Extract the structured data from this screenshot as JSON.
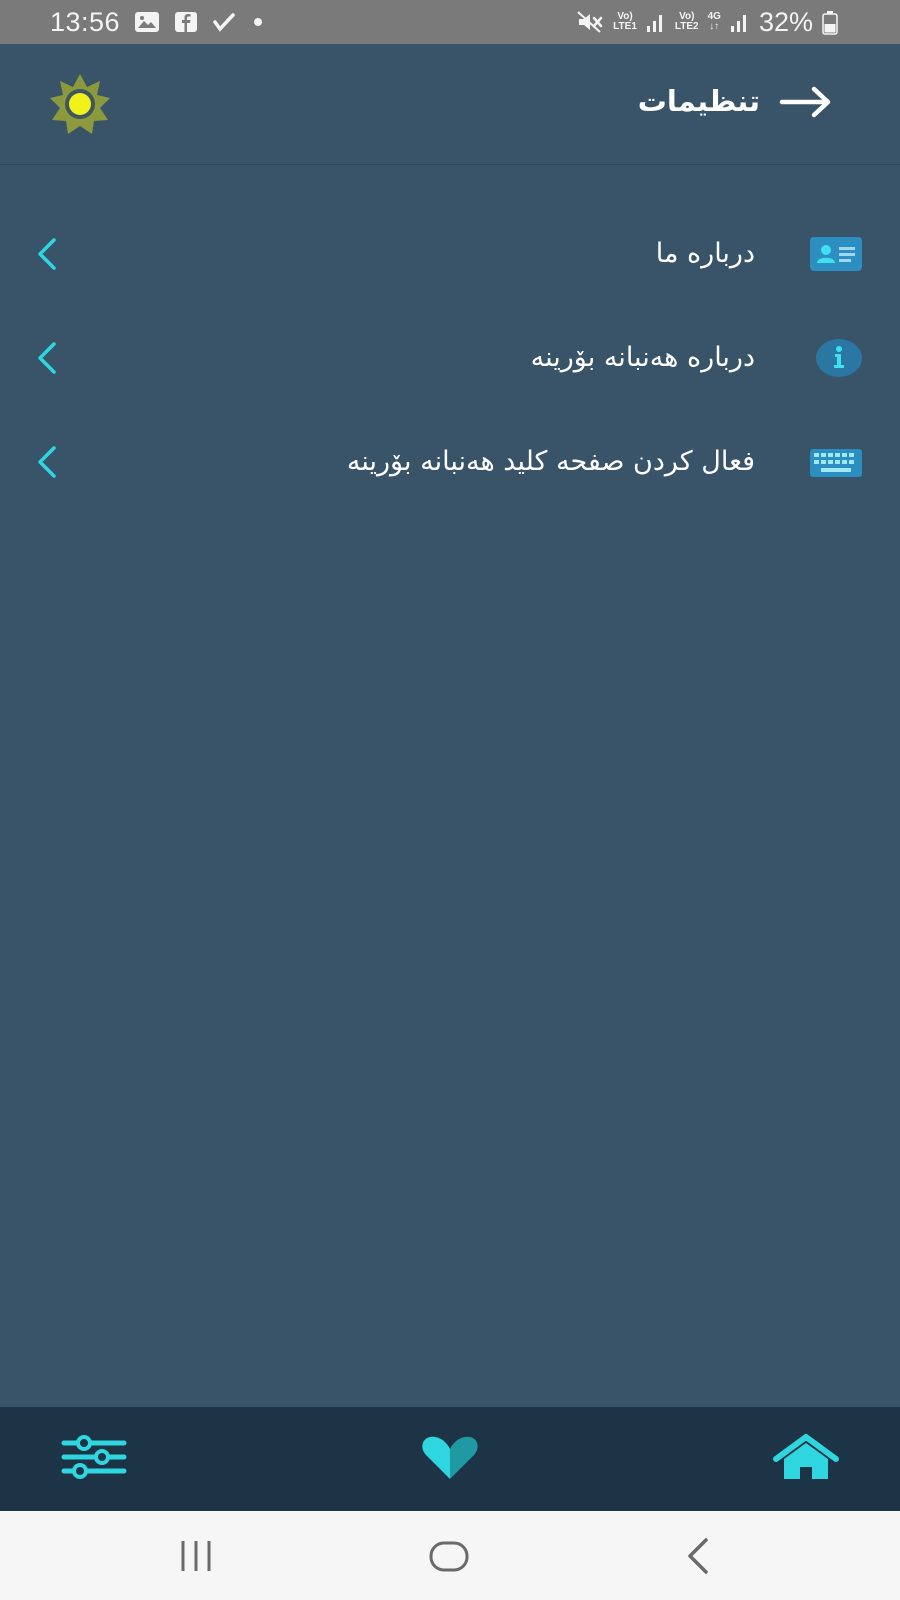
{
  "status_bar": {
    "time": "13:56",
    "battery": "32%",
    "sim1_top": "Vo)",
    "sim1_bottom": "LTE1",
    "sim2_top": "Vo)",
    "sim2_bottom": "LTE2",
    "network": "4G",
    "icons": [
      "gallery-icon",
      "facebook-icon",
      "check-icon",
      "dot-icon",
      "mute-icon",
      "signal-icon",
      "battery-icon"
    ]
  },
  "header": {
    "title": "تنظیمات",
    "back_icon": "arrow-right-icon",
    "theme_icon": "sun-icon"
  },
  "settings": {
    "items": [
      {
        "label": "درباره ما",
        "icon": "contact-card-icon"
      },
      {
        "label": "درباره هەنبانە بۆرینە",
        "icon": "info-icon"
      },
      {
        "label": "فعال کردن صفحه کلید هەنبانە بۆرینە",
        "icon": "keyboard-icon"
      }
    ]
  },
  "bottom_nav": {
    "items": [
      {
        "name": "settings",
        "icon": "sliders-icon"
      },
      {
        "name": "favorites",
        "icon": "heart-icon"
      },
      {
        "name": "home",
        "icon": "home-icon"
      }
    ]
  },
  "colors": {
    "background": "#395468",
    "bottom_nav": "#1d3346",
    "accent": "#2fd6df",
    "text": "#ffffff",
    "sun_fill": "#f1f21a",
    "sun_ray": "#8a9a3d"
  }
}
